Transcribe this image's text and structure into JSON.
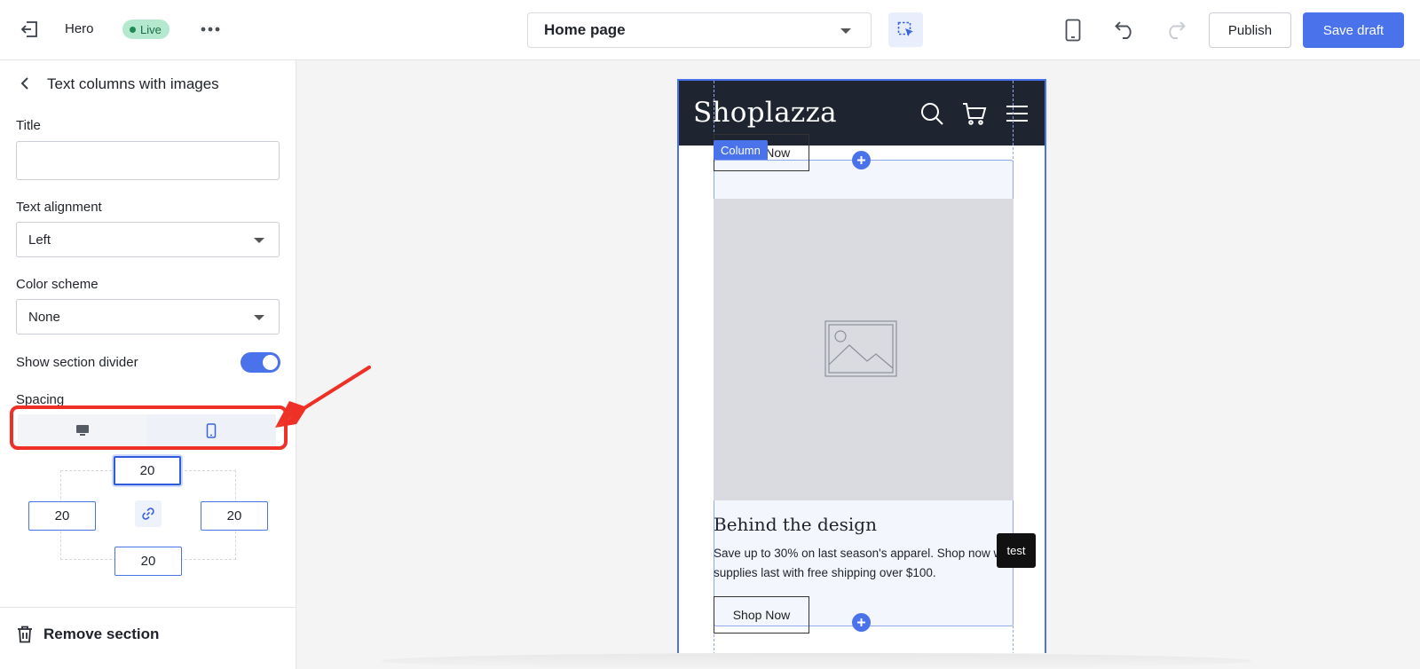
{
  "topbar": {
    "theme_name": "Hero",
    "status_badge": "Live",
    "page_selector": "Home page",
    "publish_label": "Publish",
    "save_draft_label": "Save draft",
    "icons": [
      "exit-icon",
      "more-icon",
      "chevron-down-icon",
      "select-element-icon",
      "mobile-device-icon",
      "undo-icon",
      "redo-icon"
    ]
  },
  "sidebar": {
    "title": "Text columns with images",
    "title_field": {
      "label": "Title",
      "value": ""
    },
    "text_alignment": {
      "label": "Text alignment",
      "value": "Left"
    },
    "color_scheme": {
      "label": "Color scheme",
      "value": "None"
    },
    "section_divider": {
      "label": "Show section divider",
      "on": true
    },
    "spacing": {
      "label": "Spacing",
      "tabs": [
        "desktop-icon",
        "mobile-icon"
      ],
      "active_tab": "mobile",
      "top": "20",
      "left": "20",
      "right": "20",
      "bottom": "20"
    },
    "remove_label": "Remove section"
  },
  "preview": {
    "store_name": "Shoplazza",
    "column_tag": "Column",
    "button_label": "Shop Now",
    "heading": "Behind the design",
    "body_text": "Save up to 30% on last season's apparel. Shop now while supplies last with free shipping over $100.",
    "tooltip": "test"
  },
  "colors": {
    "accent": "#4a72ea",
    "annotation": "#ef3027",
    "store_header": "#1e2530",
    "live_badge": "#b5e9cf"
  }
}
